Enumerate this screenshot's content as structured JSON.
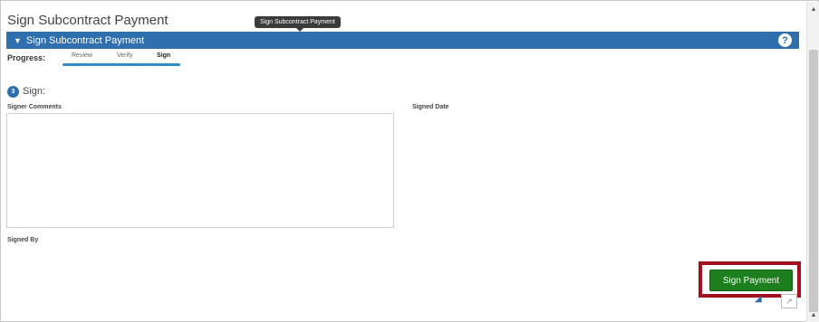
{
  "page": {
    "title": "Sign Subcontract Payment"
  },
  "tooltip": {
    "text": "Sign Subcontract Payment"
  },
  "section": {
    "title": "Sign Subcontract Payment",
    "help_icon": "question-circle-icon",
    "help_glyph": "?"
  },
  "progress": {
    "label": "Progress:",
    "steps": [
      "Review",
      "Verify",
      "Sign"
    ],
    "active_step": "Sign"
  },
  "sign_step": {
    "number": "3",
    "title": "Sign:"
  },
  "fields": {
    "signer_comments_label": "Signer Comments",
    "signer_comments_value": "",
    "signed_date_label": "Signed Date",
    "signed_by_label": "Signed By"
  },
  "actions": {
    "sign_payment_label": "Sign Payment"
  },
  "colors": {
    "header": "#2f6fae",
    "button": "#1c7e1c",
    "highlight": "#a30f1c"
  }
}
